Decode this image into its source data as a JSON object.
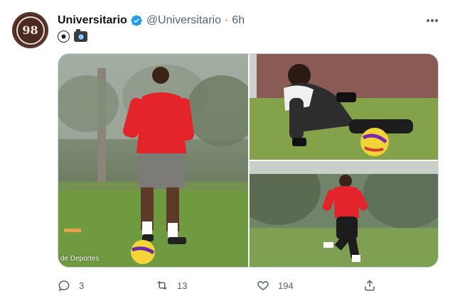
{
  "tweet": {
    "avatar_text": "98",
    "display_name": "Universitario",
    "handle": "@Universitario",
    "separator": "·",
    "time": "6h",
    "body_emojis": [
      "soccer-ball",
      "camera-with-flash"
    ],
    "more_label": "•••",
    "media": {
      "photos": [
        {
          "name": "player-dribbling",
          "caption": "de Deportes"
        },
        {
          "name": "goalkeeper-diving",
          "caption": ""
        },
        {
          "name": "player-running",
          "caption": ""
        }
      ]
    },
    "actions": {
      "reply": {
        "icon": "reply-icon",
        "count": "3"
      },
      "retweet": {
        "icon": "retweet-icon",
        "count": "13"
      },
      "like": {
        "icon": "heart-icon",
        "count": "194"
      },
      "share": {
        "icon": "share-icon",
        "count": ""
      }
    },
    "colors": {
      "verified_blue": "#1d9bf0",
      "secondary_text": "#536471",
      "jersey_red": "#e3242b"
    }
  }
}
